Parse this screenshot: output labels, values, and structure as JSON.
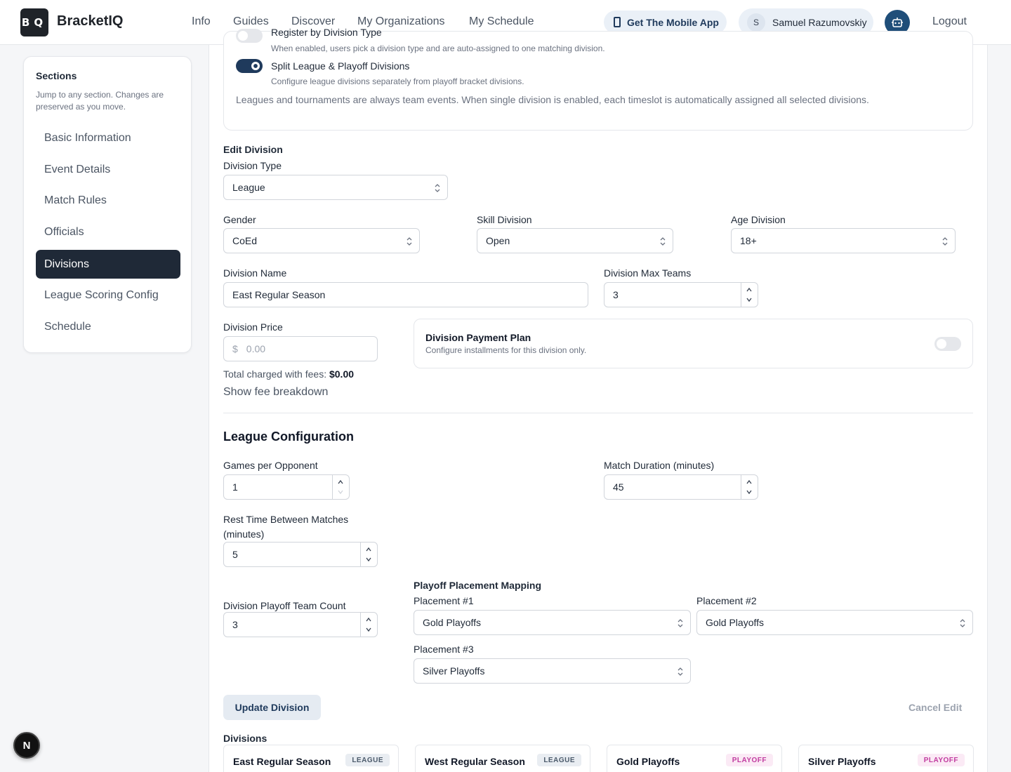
{
  "header": {
    "logo_text": "BQ",
    "brand": "BracketIQ",
    "nav": [
      "Info",
      "Guides",
      "Discover",
      "My Organizations",
      "My Schedule"
    ],
    "mobile_app": "Get The Mobile App",
    "user_initial": "S",
    "user_name": "Samuel Razumovskiy",
    "logout": "Logout"
  },
  "sidebar": {
    "title": "Sections",
    "description": "Jump to any section. Changes are preserved as you move.",
    "items": [
      {
        "label": "Basic Information",
        "active": false
      },
      {
        "label": "Event Details",
        "active": false
      },
      {
        "label": "Match Rules",
        "active": false
      },
      {
        "label": "Officials",
        "active": false
      },
      {
        "label": "Divisions",
        "active": true
      },
      {
        "label": "League Scoring Config",
        "active": false
      },
      {
        "label": "Schedule",
        "active": false
      }
    ]
  },
  "settings": {
    "register_by_type": {
      "label": "Register by Division Type",
      "desc": "When enabled, users pick a division type and are auto-assigned to one matching division.",
      "on": false
    },
    "split": {
      "label": "Split League & Playoff Divisions",
      "desc": "Configure league divisions separately from playoff bracket divisions.",
      "on": true
    },
    "note": "Leagues and tournaments are always team events. When single division is enabled, each timeslot is automatically assigned all selected divisions."
  },
  "edit": {
    "heading": "Edit Division",
    "division_type_label": "Division Type",
    "division_type": "League",
    "gender_label": "Gender",
    "gender": "CoEd",
    "skill_label": "Skill Division",
    "skill": "Open",
    "age_label": "Age Division",
    "age": "18+",
    "name_label": "Division Name",
    "name": "East Regular Season",
    "max_teams_label": "Division Max Teams",
    "max_teams": "3",
    "price_label": "Division Price",
    "currency": "$",
    "price_placeholder": "0.00",
    "total_label": "Total charged with fees:",
    "total_value": "$0.00",
    "fee_breakdown": "Show fee breakdown",
    "payment_plan_title": "Division Payment Plan",
    "payment_plan_desc": "Configure installments for this division only.",
    "payment_plan_on": false
  },
  "league": {
    "heading": "League Configuration",
    "games_label": "Games per Opponent",
    "games": "1",
    "duration_label": "Match Duration (minutes)",
    "duration": "45",
    "rest_label": "Rest Time Between Matches (minutes)",
    "rest": "5",
    "playoff_count_label": "Division Playoff Team Count",
    "playoff_count": "3",
    "mapping_heading": "Playoff Placement Mapping",
    "placements": [
      {
        "label": "Placement #1",
        "value": "Gold Playoffs"
      },
      {
        "label": "Placement #2",
        "value": "Gold Playoffs"
      },
      {
        "label": "Placement #3",
        "value": "Silver Playoffs"
      }
    ]
  },
  "actions": {
    "update": "Update Division",
    "cancel": "Cancel Edit"
  },
  "divisions": {
    "heading": "Divisions",
    "list": [
      {
        "name": "East Regular Season",
        "badge": "LEAGUE"
      },
      {
        "name": "West Regular Season",
        "badge": "LEAGUE"
      },
      {
        "name": "Gold Playoffs",
        "badge": "PLAYOFF"
      },
      {
        "name": "Silver Playoffs",
        "badge": "PLAYOFF"
      }
    ]
  },
  "dev_badge": "N",
  "colors": {
    "accent": "#1f3a5c",
    "sidebar_active": "#1f2937",
    "playoff_badge": "#c13ca0"
  }
}
